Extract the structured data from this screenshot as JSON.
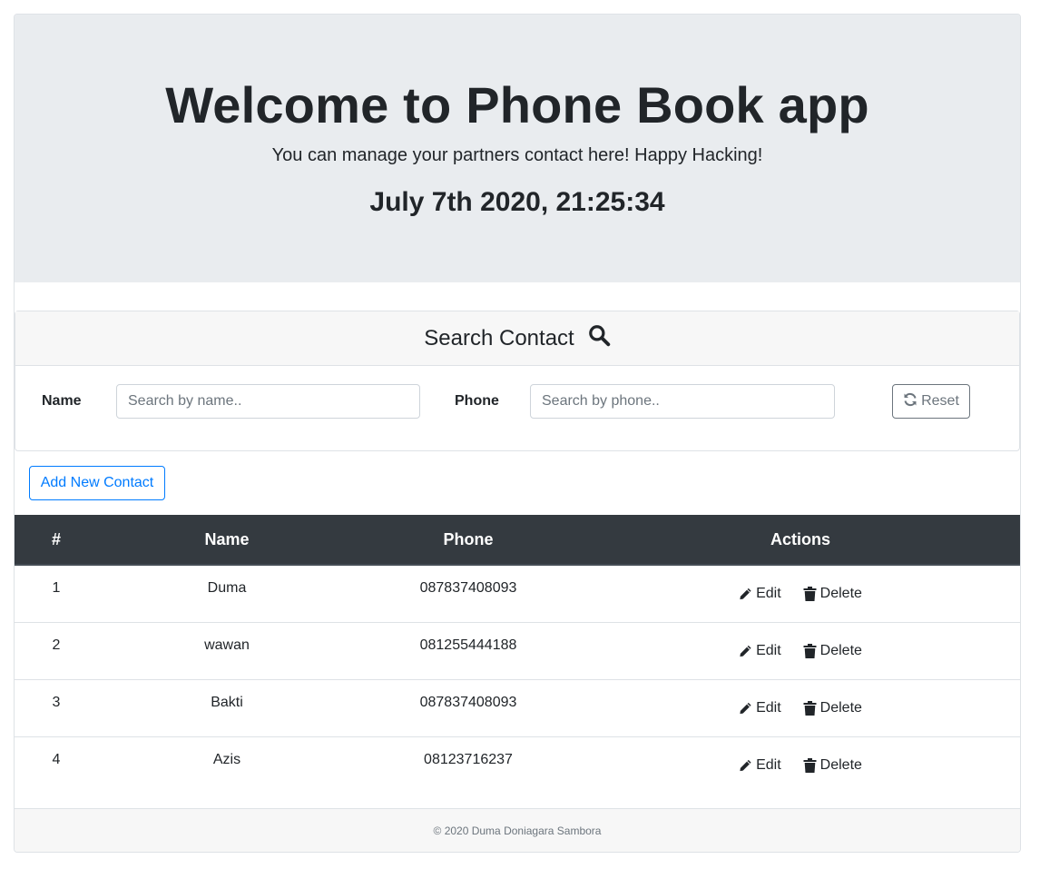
{
  "hero": {
    "title": "Welcome to Phone Book app",
    "subtitle": "You can manage your partners contact here! Happy Hacking!",
    "datetime": "July 7th 2020, 21:25:34"
  },
  "search": {
    "header": "Search Contact",
    "icon": "search-icon",
    "name_label": "Name",
    "name_placeholder": "Search by name..",
    "name_value": "",
    "phone_label": "Phone",
    "phone_placeholder": "Search by phone..",
    "phone_value": "",
    "reset_label": "Reset",
    "reset_icon": "refresh-icon"
  },
  "add_button_label": "Add New Contact",
  "table": {
    "headers": [
      "#",
      "Name",
      "Phone",
      "Actions"
    ],
    "rows": [
      {
        "num": "1",
        "name": "Duma",
        "phone": "087837408093"
      },
      {
        "num": "2",
        "name": "wawan",
        "phone": "081255444188"
      },
      {
        "num": "3",
        "name": "Bakti",
        "phone": "087837408093"
      },
      {
        "num": "4",
        "name": "Azis",
        "phone": "08123716237"
      }
    ],
    "edit_label": "Edit",
    "delete_label": "Delete"
  },
  "footer": "© 2020 Duma Doniagara Sambora",
  "colors": {
    "header_bg": "#e9ecef",
    "table_head": "#343a40",
    "primary": "#007bff",
    "secondary": "#6c757d"
  }
}
